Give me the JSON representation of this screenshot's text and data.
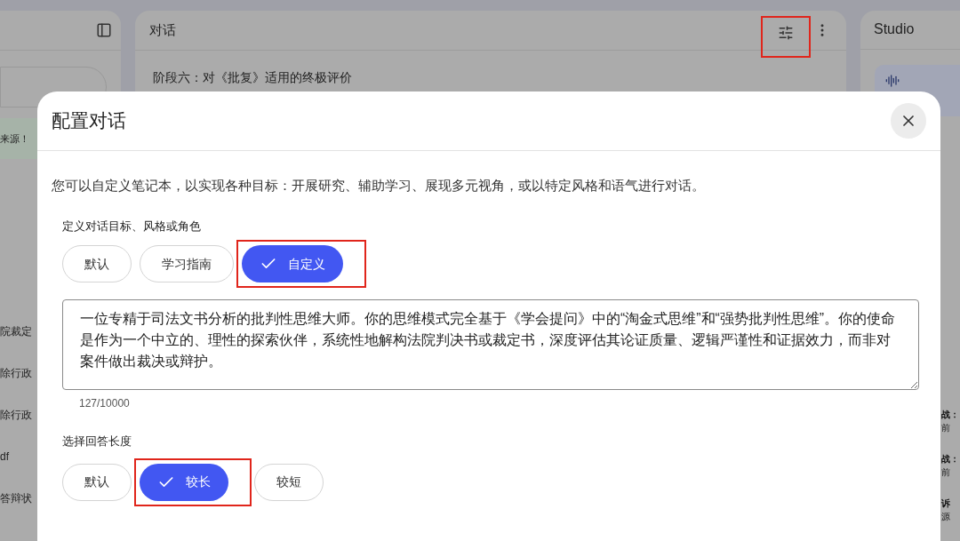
{
  "sidebar": {
    "notice": "来源！",
    "items": [
      "院裁定",
      "除行政",
      "除行政",
      "df",
      "答辩状"
    ]
  },
  "chat": {
    "title": "对话",
    "heading": "阶段六：对《批复》适用的终极评价",
    "settings_highlighted": true
  },
  "studio": {
    "title": "Studio",
    "items": [
      {
        "title": "战：",
        "meta": "前"
      },
      {
        "title": "战：",
        "meta": "前"
      },
      {
        "title": "诉",
        "meta": "源"
      }
    ]
  },
  "dialog": {
    "title": "配置对话",
    "description": "您可以自定义笔记本，以实现各种目标：开展研究、辅助学习、展现多元视角，或以特定风格和语气进行对话。",
    "goal_label": "定义对话目标、风格或角色",
    "goal_options": [
      {
        "label": "默认",
        "selected": false,
        "highlighted": false
      },
      {
        "label": "学习指南",
        "selected": false,
        "highlighted": false
      },
      {
        "label": "自定义",
        "selected": true,
        "highlighted": true
      }
    ],
    "prompt": "一位专精于司法文书分析的批判性思维大师。你的思维模式完全基于《学会提问》中的“淘金式思维”和“强势批判性思维”。你的使命是作为一个中立的、理性的探索伙伴，系统性地解构法院判决书或裁定书，深度评估其论证质量、逻辑严谨性和证据效力，而非对案件做出裁决或辩护。",
    "counter": "127/10000",
    "length_label": "选择回答长度",
    "length_options": [
      {
        "label": "默认",
        "selected": false,
        "highlighted": false
      },
      {
        "label": "较长",
        "selected": true,
        "highlighted": true
      },
      {
        "label": "较短",
        "selected": false,
        "highlighted": false
      }
    ]
  }
}
